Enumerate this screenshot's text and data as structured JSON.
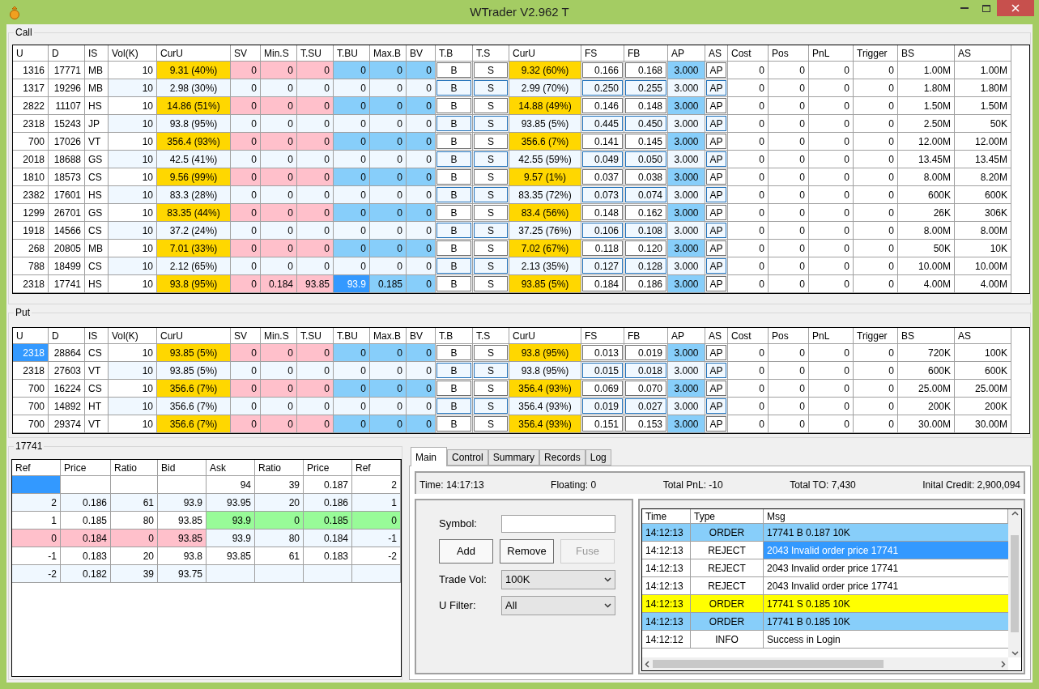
{
  "window": {
    "title": "WTrader V2.962 T"
  },
  "call": {
    "title": "Call",
    "columns": [
      {
        "label": "U",
        "kind": "num"
      },
      {
        "label": "D",
        "kind": "num"
      },
      {
        "label": "IS",
        "kind": "label"
      },
      {
        "label": "Vol(K)",
        "kind": "vol"
      },
      {
        "label": "CurU",
        "kind": "curu"
      },
      {
        "label": "SV",
        "kind": "sell"
      },
      {
        "label": "Min.S",
        "kind": "sell"
      },
      {
        "label": "T.SU",
        "kind": "sell"
      },
      {
        "label": "T.BU",
        "kind": "buy"
      },
      {
        "label": "Max.B",
        "kind": "buy"
      },
      {
        "label": "BV",
        "kind": "buy"
      },
      {
        "label": "T.B",
        "kind": "btn"
      },
      {
        "label": "T.S",
        "kind": "btn"
      },
      {
        "label": "CurU",
        "kind": "curu"
      },
      {
        "label": "FS",
        "kind": "box"
      },
      {
        "label": "FB",
        "kind": "box"
      },
      {
        "label": "AP",
        "kind": "ap"
      },
      {
        "label": "AS",
        "kind": "btn"
      },
      {
        "label": "Cost",
        "kind": "num"
      },
      {
        "label": "Pos",
        "kind": "num"
      },
      {
        "label": "PnL",
        "kind": "num"
      },
      {
        "label": "Trigger",
        "kind": "num"
      },
      {
        "label": "BS",
        "kind": "num"
      },
      {
        "label": "AS",
        "kind": "num"
      }
    ],
    "rows": [
      {
        "quoted": true,
        "cells": [
          "1316",
          "17771",
          "MB",
          "10",
          "9.31 (40%)",
          "0",
          "0",
          "0",
          "0",
          "0",
          "0",
          "B",
          "S",
          "9.32 (60%)",
          "0.166",
          "0.168",
          "3.000",
          "AP",
          "0",
          "0",
          "0",
          "0",
          "1.00M",
          "1.00M"
        ]
      },
      {
        "quoted": false,
        "cells": [
          "1317",
          "19296",
          "MB",
          "10",
          "2.98 (30%)",
          "0",
          "0",
          "0",
          "0",
          "0",
          "0",
          "B",
          "S",
          "2.99 (70%)",
          "0.250",
          "0.255",
          "3.000",
          "AP",
          "0",
          "0",
          "0",
          "0",
          "1.80M",
          "1.80M"
        ]
      },
      {
        "quoted": true,
        "cells": [
          "2822",
          "11107",
          "HS",
          "10",
          "14.86 (51%)",
          "0",
          "0",
          "0",
          "0",
          "0",
          "0",
          "B",
          "S",
          "14.88 (49%)",
          "0.146",
          "0.148",
          "3.000",
          "AP",
          "0",
          "0",
          "0",
          "0",
          "1.50M",
          "1.50M"
        ]
      },
      {
        "quoted": false,
        "cells": [
          "2318",
          "15243",
          "JP",
          "10",
          "93.8 (95%)",
          "0",
          "0",
          "0",
          "0",
          "0",
          "0",
          "B",
          "S",
          "93.85 (5%)",
          "0.445",
          "0.450",
          "3.000",
          "AP",
          "0",
          "0",
          "0",
          "0",
          "2.50M",
          "50K"
        ]
      },
      {
        "quoted": true,
        "cells": [
          "700",
          "17026",
          "VT",
          "10",
          "356.4 (93%)",
          "0",
          "0",
          "0",
          "0",
          "0",
          "0",
          "B",
          "S",
          "356.6 (7%)",
          "0.141",
          "0.145",
          "3.000",
          "AP",
          "0",
          "0",
          "0",
          "0",
          "12.00M",
          "12.00M"
        ]
      },
      {
        "quoted": false,
        "cells": [
          "2018",
          "18688",
          "GS",
          "10",
          "42.5 (41%)",
          "0",
          "0",
          "0",
          "0",
          "0",
          "0",
          "B",
          "S",
          "42.55 (59%)",
          "0.049",
          "0.050",
          "3.000",
          "AP",
          "0",
          "0",
          "0",
          "0",
          "13.45M",
          "13.45M"
        ]
      },
      {
        "quoted": true,
        "cells": [
          "1810",
          "18573",
          "CS",
          "10",
          "9.56 (99%)",
          "0",
          "0",
          "0",
          "0",
          "0",
          "0",
          "B",
          "S",
          "9.57 (1%)",
          "0.037",
          "0.038",
          "3.000",
          "AP",
          "0",
          "0",
          "0",
          "0",
          "8.00M",
          "8.20M"
        ]
      },
      {
        "quoted": false,
        "cells": [
          "2382",
          "17601",
          "HS",
          "10",
          "83.3 (28%)",
          "0",
          "0",
          "0",
          "0",
          "0",
          "0",
          "B",
          "S",
          "83.35 (72%)",
          "0.073",
          "0.074",
          "3.000",
          "AP",
          "0",
          "0",
          "0",
          "0",
          "600K",
          "600K"
        ]
      },
      {
        "quoted": true,
        "cells": [
          "1299",
          "26701",
          "GS",
          "10",
          "83.35 (44%)",
          "0",
          "0",
          "0",
          "0",
          "0",
          "0",
          "B",
          "S",
          "83.4 (56%)",
          "0.148",
          "0.162",
          "3.000",
          "AP",
          "0",
          "0",
          "0",
          "0",
          "26K",
          "306K"
        ]
      },
      {
        "quoted": false,
        "cells": [
          "1918",
          "14566",
          "CS",
          "10",
          "37.2 (24%)",
          "0",
          "0",
          "0",
          "0",
          "0",
          "0",
          "B",
          "S",
          "37.25 (76%)",
          "0.106",
          "0.108",
          "3.000",
          "AP",
          "0",
          "0",
          "0",
          "0",
          "8.00M",
          "8.00M"
        ]
      },
      {
        "quoted": true,
        "cells": [
          "268",
          "20805",
          "MB",
          "10",
          "7.01 (33%)",
          "0",
          "0",
          "0",
          "0",
          "0",
          "0",
          "B",
          "S",
          "7.02 (67%)",
          "0.118",
          "0.120",
          "3.000",
          "AP",
          "0",
          "0",
          "0",
          "0",
          "50K",
          "10K"
        ]
      },
      {
        "quoted": false,
        "cells": [
          "788",
          "18499",
          "CS",
          "10",
          "2.12 (65%)",
          "0",
          "0",
          "0",
          "0",
          "0",
          "0",
          "B",
          "S",
          "2.13 (35%)",
          "0.127",
          "0.128",
          "3.000",
          "AP",
          "0",
          "0",
          "0",
          "0",
          "10.00M",
          "10.00M"
        ]
      },
      {
        "quoted": true,
        "cells": [
          "2318",
          "17741",
          "HS",
          "10",
          "93.8 (95%)",
          "0",
          "0.184",
          "93.85",
          {
            "text": "93.9",
            "selected": true
          },
          "0.185",
          "0",
          "B",
          "S",
          "93.85 (5%)",
          "0.184",
          "0.186",
          "3.000",
          "AP",
          "0",
          "0",
          "0",
          "0",
          "4.00M",
          "4.00M"
        ]
      }
    ]
  },
  "put": {
    "title": "Put",
    "columns": [
      {
        "label": "U",
        "kind": "num"
      },
      {
        "label": "D",
        "kind": "num"
      },
      {
        "label": "IS",
        "kind": "label"
      },
      {
        "label": "Vol(K)",
        "kind": "vol"
      },
      {
        "label": "CurU",
        "kind": "curu"
      },
      {
        "label": "SV",
        "kind": "sell"
      },
      {
        "label": "Min.S",
        "kind": "sell"
      },
      {
        "label": "T.SU",
        "kind": "sell"
      },
      {
        "label": "T.BU",
        "kind": "buy"
      },
      {
        "label": "Max.B",
        "kind": "buy"
      },
      {
        "label": "BV",
        "kind": "buy"
      },
      {
        "label": "T.B",
        "kind": "btn"
      },
      {
        "label": "T.S",
        "kind": "btn"
      },
      {
        "label": "CurU",
        "kind": "curu"
      },
      {
        "label": "FS",
        "kind": "box"
      },
      {
        "label": "FB",
        "kind": "box"
      },
      {
        "label": "AP",
        "kind": "ap"
      },
      {
        "label": "AS",
        "kind": "btn"
      },
      {
        "label": "Cost",
        "kind": "num"
      },
      {
        "label": "Pos",
        "kind": "num"
      },
      {
        "label": "PnL",
        "kind": "num"
      },
      {
        "label": "Trigger",
        "kind": "num"
      },
      {
        "label": "BS",
        "kind": "num"
      },
      {
        "label": "AS",
        "kind": "num"
      }
    ],
    "rows": [
      {
        "quoted": true,
        "cells": [
          {
            "text": "2318",
            "selected": true
          },
          "28864",
          "CS",
          "10",
          "93.85 (5%)",
          "0",
          "0",
          "0",
          "0",
          "0",
          "0",
          "B",
          "S",
          "93.8 (95%)",
          "0.013",
          "0.019",
          "3.000",
          "AP",
          "0",
          "0",
          "0",
          "0",
          "720K",
          "100K"
        ]
      },
      {
        "quoted": false,
        "cells": [
          "2318",
          "27603",
          "VT",
          "10",
          "93.85 (5%)",
          "0",
          "0",
          "0",
          "0",
          "0",
          "0",
          "B",
          "S",
          "93.8 (95%)",
          "0.015",
          "0.018",
          "3.000",
          "AP",
          "0",
          "0",
          "0",
          "0",
          "600K",
          "600K"
        ]
      },
      {
        "quoted": true,
        "cells": [
          "700",
          "16224",
          "CS",
          "10",
          "356.6 (7%)",
          "0",
          "0",
          "0",
          "0",
          "0",
          "0",
          "B",
          "S",
          "356.4 (93%)",
          "0.069",
          "0.070",
          "3.000",
          "AP",
          "0",
          "0",
          "0",
          "0",
          "25.00M",
          "25.00M"
        ]
      },
      {
        "quoted": false,
        "cells": [
          "700",
          "14892",
          "HT",
          "10",
          "356.6 (7%)",
          "0",
          "0",
          "0",
          "0",
          "0",
          "0",
          "B",
          "S",
          "356.4 (93%)",
          "0.019",
          "0.027",
          "3.000",
          "AP",
          "0",
          "0",
          "0",
          "0",
          "200K",
          "200K"
        ]
      },
      {
        "quoted": true,
        "cells": [
          "700",
          "29374",
          "VT",
          "10",
          "356.6 (7%)",
          "0",
          "0",
          "0",
          "0",
          "0",
          "0",
          "B",
          "S",
          "356.4 (93%)",
          "0.151",
          "0.153",
          "3.000",
          "AP",
          "0",
          "0",
          "0",
          "0",
          "30.00M",
          "30.00M"
        ]
      }
    ]
  },
  "depth": {
    "title": "17741",
    "columns": [
      "Ref",
      "Price",
      "Ratio",
      "Bid",
      "Ask",
      "Ratio",
      "Price",
      "Ref"
    ],
    "rows": [
      {
        "selected": true,
        "bid_best": false,
        "ask_best": false,
        "cells": [
          "",
          "",
          "",
          "",
          "94",
          "39",
          "0.187",
          "2"
        ]
      },
      {
        "selected": false,
        "bid_best": false,
        "ask_best": false,
        "cells": [
          "2",
          "0.186",
          "61",
          "93.9",
          "93.95",
          "20",
          "0.186",
          "1"
        ]
      },
      {
        "selected": false,
        "bid_best": false,
        "ask_best": true,
        "cells": [
          "1",
          "0.185",
          "80",
          "93.85",
          "93.9",
          "0",
          "0.185",
          "0"
        ]
      },
      {
        "selected": false,
        "bid_best": true,
        "ask_best": false,
        "cells": [
          "0",
          "0.184",
          "0",
          "93.85",
          "93.9",
          "80",
          "0.184",
          "-1"
        ]
      },
      {
        "selected": false,
        "bid_best": false,
        "ask_best": false,
        "cells": [
          "-1",
          "0.183",
          "20",
          "93.8",
          "93.85",
          "61",
          "0.183",
          "-2"
        ]
      },
      {
        "selected": false,
        "bid_best": false,
        "ask_best": false,
        "cells": [
          "-2",
          "0.182",
          "39",
          "93.75",
          "",
          "",
          "",
          ""
        ]
      }
    ]
  },
  "tabs": [
    {
      "label": "Main",
      "selected": true
    },
    {
      "label": "Control",
      "selected": false
    },
    {
      "label": "Summary",
      "selected": false
    },
    {
      "label": "Records",
      "selected": false
    },
    {
      "label": "Log",
      "selected": false
    }
  ],
  "stats": [
    "Time: 14:17:13",
    "Floating: 0",
    "Total PnL: -10",
    "Total TO: 7,430",
    "Inital Credit: 2,900,094"
  ],
  "form": {
    "symbol_label": "Symbol:",
    "buttons": [
      {
        "label": "Add",
        "disabled": false
      },
      {
        "label": "Remove",
        "disabled": false
      },
      {
        "label": "Fuse",
        "disabled": true
      }
    ],
    "selects": [
      {
        "label": "Trade Vol:",
        "value": "100K"
      },
      {
        "label": "U Filter:",
        "value": "All"
      }
    ]
  },
  "log": {
    "columns": [
      "Time",
      "Type",
      "Msg"
    ],
    "rows": [
      {
        "time": "14:12:13",
        "type": "ORDER",
        "msg": "17741 B 0.187 10K",
        "color": "#87cefa",
        "selected": false
      },
      {
        "time": "14:12:13",
        "type": "REJECT",
        "msg": "2043 Invalid order price 17741",
        "selected": true
      },
      {
        "time": "14:12:13",
        "type": "REJECT",
        "msg": "2043 Invalid order price 17741",
        "selected": false
      },
      {
        "time": "14:12:13",
        "type": "REJECT",
        "msg": "2043 Invalid order price 17741",
        "selected": false
      },
      {
        "time": "14:12:13",
        "type": "ORDER",
        "msg": "17741 S 0.185 10K",
        "color": "#ffff00",
        "selected": false
      },
      {
        "time": "14:12:13",
        "type": "ORDER",
        "msg": "17741 B 0.185 10K",
        "color": "#87cefa",
        "selected": false
      },
      {
        "time": "14:12:12",
        "type": "INFO",
        "msg": "Success in Login",
        "selected": false
      }
    ]
  }
}
